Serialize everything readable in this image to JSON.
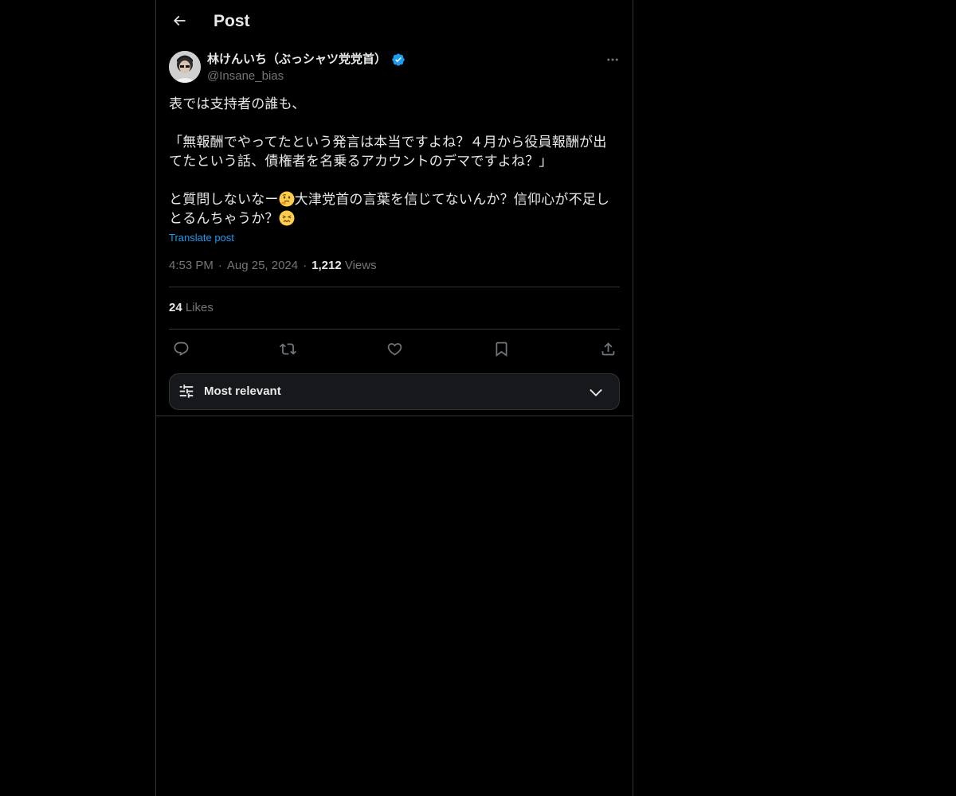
{
  "header": {
    "title": "Post",
    "back_icon": "arrow-left-icon"
  },
  "post": {
    "author_name": "林けんいち（ぶっシャツ党党首）",
    "handle": "@Insane_bias",
    "verified": true,
    "verified_color": "#1d9bf0",
    "text_line1": "表では支持者の誰も、",
    "text_line2": "「無報酬でやってたという発言は本当ですよね？４月から役員報酬が出てたという話、債権者を名乗るアカウントのデマですよね？」",
    "text_line3a": "と質問しないなー",
    "text_line3b": "大津党首の言葉を信じてないんか？信仰心が不足しとるんちゃうか？",
    "emoji_1": "thinking-face",
    "emoji_2": "persevering-face",
    "translate_label": "Translate post",
    "time": "4:53 PM",
    "date": "Aug 25, 2024",
    "views_count": "1,212",
    "views_label": "Views",
    "likes_count": "24",
    "likes_label": "Likes",
    "separator": "·"
  },
  "actions": {
    "reply_icon": "reply-icon",
    "repost_icon": "repost-icon",
    "like_icon": "heart-icon",
    "bookmark_icon": "bookmark-icon",
    "share_icon": "share-icon"
  },
  "sort": {
    "label": "Most relevant"
  },
  "colors": {
    "background": "#000000",
    "text_primary": "#e7e9ea",
    "text_secondary": "#71767b",
    "accent": "#1d9bf0",
    "border": "#2f3336"
  }
}
